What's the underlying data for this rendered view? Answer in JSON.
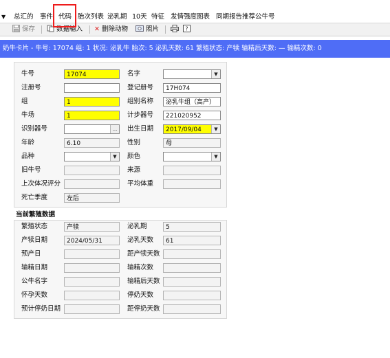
{
  "menu": {
    "dropdown_arrow": "▼",
    "items": [
      "总汇的",
      "事件",
      "代码",
      "胎次列表",
      "泌乳期",
      "10天",
      "特征",
      "发情强度图表",
      "同期报告推荐公牛号"
    ]
  },
  "toolbar": {
    "save": "保存",
    "bulk_input": "数据输入",
    "delete_animal": "删除动物",
    "photo": "照片"
  },
  "banner": {
    "text": "奶牛卡片 - 牛号: 17074   组: 1   状况: 泌乳牛   胎次: 5   泌乳天数: 61   繁殖状态: 产犊   输精后天数: —   输精次数: 0"
  },
  "basic": {
    "cow_no": {
      "label": "牛号",
      "value": "17074"
    },
    "name": {
      "label": "名字",
      "value": ""
    },
    "reg_no": {
      "label": "注册号",
      "value": ""
    },
    "reg_book_no": {
      "label": "登记册号",
      "value": "17H074"
    },
    "group": {
      "label": "组",
      "value": "1"
    },
    "group_name": {
      "label": "组别名称",
      "value": "泌乳牛组（高产）"
    },
    "farm": {
      "label": "牛场",
      "value": "1"
    },
    "pedometer": {
      "label": "计步器号",
      "value": "221020952"
    },
    "id_tag": {
      "label": "识别器号",
      "value": ""
    },
    "birth_date": {
      "label": "出生日期",
      "value": "2017/09/04"
    },
    "age": {
      "label": "年龄",
      "value": "6.10"
    },
    "sex": {
      "label": "性别",
      "value": "母"
    },
    "breed": {
      "label": "品种",
      "value": ""
    },
    "color": {
      "label": "颜色",
      "value": ""
    },
    "old_no": {
      "label": "旧牛号",
      "value": ""
    },
    "source": {
      "label": "来源",
      "value": ""
    },
    "last_bcs": {
      "label": "上次体况评分",
      "value": ""
    },
    "avg_weight": {
      "label": "平均体重",
      "value": ""
    },
    "death_season": {
      "label": "死亡季度",
      "value": "左后"
    },
    "ellipsis": "..."
  },
  "repro": {
    "title": "当前繁殖数据",
    "status": {
      "label": "繁殖状态",
      "value": "产犊"
    },
    "lact_period": {
      "label": "泌乳期",
      "value": "5"
    },
    "calving_date": {
      "label": "产犊日期",
      "value": "2024/05/31"
    },
    "dim": {
      "label": "泌乳天数",
      "value": "61"
    },
    "due_date": {
      "label": "预产日",
      "value": ""
    },
    "days_to_calving": {
      "label": "距产犊天数",
      "value": ""
    },
    "insem_date": {
      "label": "输精日期",
      "value": ""
    },
    "insem_count": {
      "label": "输精次数",
      "value": ""
    },
    "bull_name": {
      "label": "公牛名字",
      "value": ""
    },
    "days_after_insem": {
      "label": "输精后天数",
      "value": ""
    },
    "preg_days": {
      "label": "怀孕天数",
      "value": ""
    },
    "dry_days": {
      "label": "停奶天数",
      "value": ""
    },
    "exp_dry_date": {
      "label": "预计停奶日期",
      "value": ""
    },
    "days_to_dry": {
      "label": "距停奶天数",
      "value": ""
    }
  },
  "colors": {
    "banner": "#4f6df6",
    "highlight": "#ee1c1c",
    "required_field": "#ffff00"
  }
}
